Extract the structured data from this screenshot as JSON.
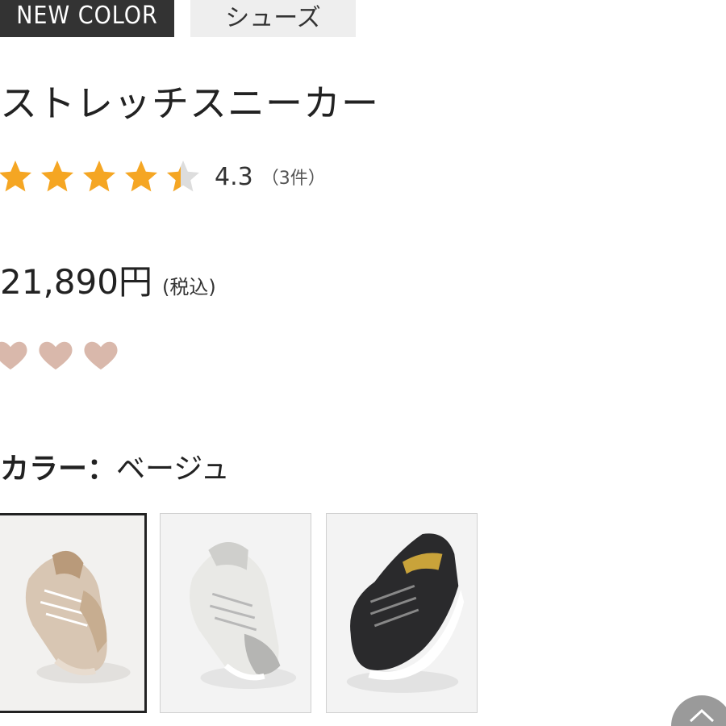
{
  "tags": {
    "new_color": "NEW COLOR",
    "category": "シューズ"
  },
  "product": {
    "title": "ストレッチスニーカー",
    "rating": {
      "value": "4.3",
      "count": "（3件）",
      "stars_filled": 4.3,
      "stars_max": 5,
      "star_color": "#f5a623",
      "star_empty_color": "#dddddd"
    },
    "price": "21,890円",
    "price_tax_note": "(税込)",
    "hearts": {
      "count": 3,
      "color": "#d9b8ab"
    },
    "color_label": "カラー：",
    "color_value": "ベージュ",
    "swatches": [
      {
        "name": "beige",
        "selected": true,
        "icon": "beige-sneaker"
      },
      {
        "name": "silver",
        "selected": false,
        "icon": "silver-sneaker"
      },
      {
        "name": "black",
        "selected": false,
        "icon": "black-sneaker"
      }
    ]
  },
  "scroll_top": {
    "icon": "chevron-up-icon"
  }
}
